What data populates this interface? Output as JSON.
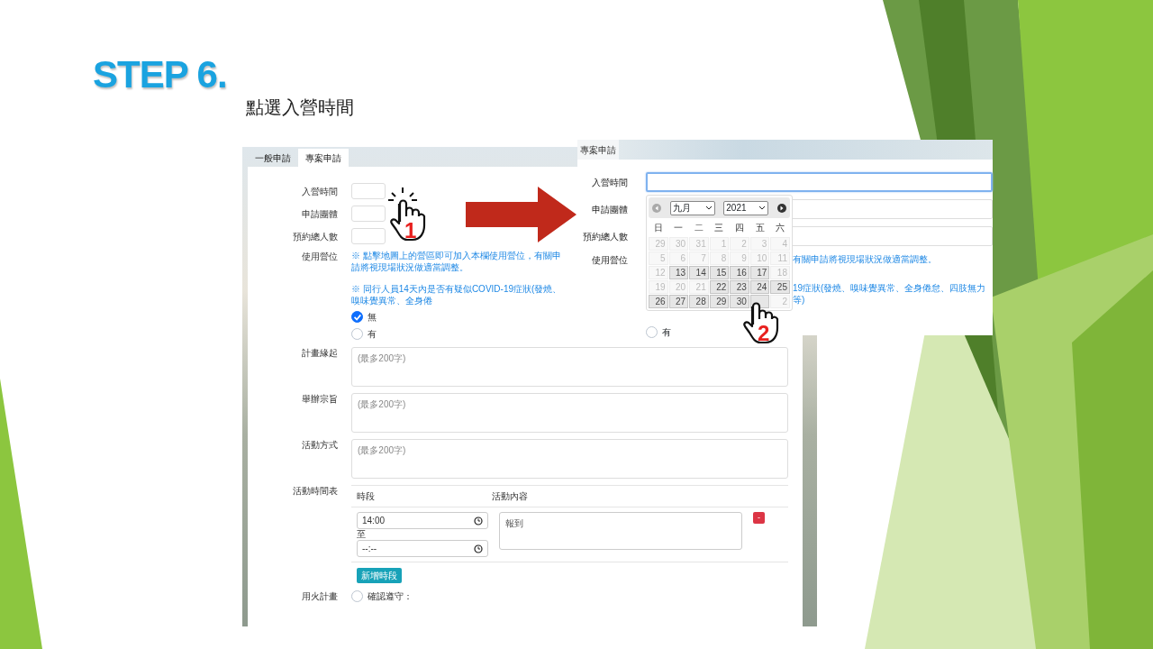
{
  "slide": {
    "title": "STEP 6.",
    "subtitle": "點選入營時間"
  },
  "left_screenshot": {
    "tabs": [
      {
        "label": "一般申請",
        "selected": false
      },
      {
        "label": "專案申請",
        "selected": true
      }
    ],
    "fields": [
      {
        "label": "入營時間"
      },
      {
        "label": "申請團體"
      },
      {
        "label": "預約總人數"
      }
    ],
    "campsite": {
      "label": "使用營位",
      "map_note": "※ 點擊地圖上的營區即可加入本欄使用營位，有關申請將視現場狀況做適當調整。",
      "covid_note": "※ 同行人員14天內是否有疑似COVID-19症狀(發燒、嗅味覺異常、全身倦",
      "options": [
        {
          "label": "無",
          "checked": true
        },
        {
          "label": "有",
          "checked": false
        }
      ]
    },
    "textareas": [
      {
        "label": "計畫緣起",
        "placeholder": "(最多200字)"
      },
      {
        "label": "舉辦宗旨",
        "placeholder": "(最多200字)"
      },
      {
        "label": "活動方式",
        "placeholder": "(最多200字)"
      }
    ],
    "schedule": {
      "label": "活動時間表",
      "columns": [
        "時段",
        "活動內容"
      ],
      "rows": [
        {
          "start": "14:00",
          "separator": "至",
          "end": "--:--",
          "content": "報到",
          "remove": "-"
        }
      ],
      "add_button": "新增時段"
    },
    "fire_plan": {
      "label": "用火計畫",
      "checked": false,
      "confirm": "確認遵守："
    }
  },
  "pointers": [
    "1",
    "2"
  ],
  "right_screenshot": {
    "tab": "專案申請",
    "fields": [
      {
        "label": "入營時間",
        "focused": true
      },
      {
        "label": "申請團體",
        "focused": false
      },
      {
        "label": "預約總人數",
        "focused": false
      }
    ],
    "campsite_label": "使用營位",
    "map_note": "有關申請將視現場狀況做適當調整。",
    "covid_note": "19症狀(發燒、嗅味覺異常、全身倦怠、四肢無力等)",
    "options": [
      {
        "label": "有",
        "checked": false
      }
    ],
    "datepicker": {
      "month": "九月",
      "year": "2021",
      "weekdays": [
        "日",
        "一",
        "二",
        "三",
        "四",
        "五",
        "六"
      ],
      "days": [
        {
          "label": "29",
          "disabled": true
        },
        {
          "label": "30",
          "disabled": true
        },
        {
          "label": "31",
          "disabled": true
        },
        {
          "label": "1",
          "disabled": true
        },
        {
          "label": "2",
          "disabled": true
        },
        {
          "label": "3",
          "disabled": true
        },
        {
          "label": "4",
          "disabled": true
        },
        {
          "label": "5",
          "disabled": true
        },
        {
          "label": "6",
          "disabled": true
        },
        {
          "label": "7",
          "disabled": true
        },
        {
          "label": "8",
          "disabled": true
        },
        {
          "label": "9",
          "disabled": true
        },
        {
          "label": "10",
          "disabled": true
        },
        {
          "label": "11",
          "disabled": true
        },
        {
          "label": "12",
          "disabled": true
        },
        {
          "label": "13",
          "disabled": false
        },
        {
          "label": "14",
          "disabled": false
        },
        {
          "label": "15",
          "disabled": false
        },
        {
          "label": "16",
          "disabled": false
        },
        {
          "label": "17",
          "disabled": false
        },
        {
          "label": "18",
          "disabled": true
        },
        {
          "label": "19",
          "disabled": true
        },
        {
          "label": "20",
          "disabled": true
        },
        {
          "label": "21",
          "disabled": true
        },
        {
          "label": "22",
          "disabled": false
        },
        {
          "label": "23",
          "disabled": false
        },
        {
          "label": "24",
          "disabled": false
        },
        {
          "label": "25",
          "disabled": false
        },
        {
          "label": "26",
          "disabled": false
        },
        {
          "label": "27",
          "disabled": false
        },
        {
          "label": "28",
          "disabled": false
        },
        {
          "label": "29",
          "disabled": false
        },
        {
          "label": "30",
          "disabled": false
        },
        {
          "disabled": false
        },
        {
          "label": "2",
          "disabled": true
        }
      ]
    }
  }
}
